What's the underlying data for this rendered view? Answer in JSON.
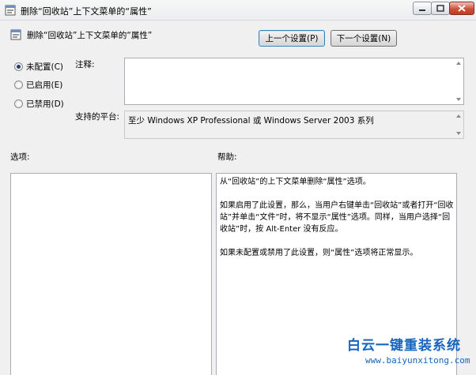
{
  "window": {
    "title": "删除“回收站”上下文菜单的“属性”"
  },
  "header": {
    "title": "删除“回收站”上下文菜单的“属性”",
    "prev_label": "上一个设置(P)",
    "next_label": "下一个设置(N)"
  },
  "state": {
    "options": [
      {
        "label": "未配置(C)",
        "selected": true
      },
      {
        "label": "已启用(E)",
        "selected": false
      },
      {
        "label": "已禁用(D)",
        "selected": false
      }
    ]
  },
  "comment": {
    "label": "注释:",
    "value": ""
  },
  "platform": {
    "label": "支持的平台:",
    "value": "至少 Windows XP Professional 或 Windows Server 2003 系列"
  },
  "options_panel": {
    "label": "选项:"
  },
  "help_panel": {
    "label": "帮助:",
    "paragraphs": [
      "从“回收站”的上下文菜单删除“属性”选项。",
      "如果启用了此设置，那么，当用户右键单击“回收站”或者打开“回收站”并单击“文件”时，将不显示“属性”选项。同样，当用户选择“回收站”时，按 Alt-Enter 没有反应。",
      "如果未配置或禁用了此设置，则“属性”选项将正常显示。"
    ]
  },
  "watermark": {
    "text": "白云一键重装系统",
    "url": "www.baiyunxitong.com"
  }
}
